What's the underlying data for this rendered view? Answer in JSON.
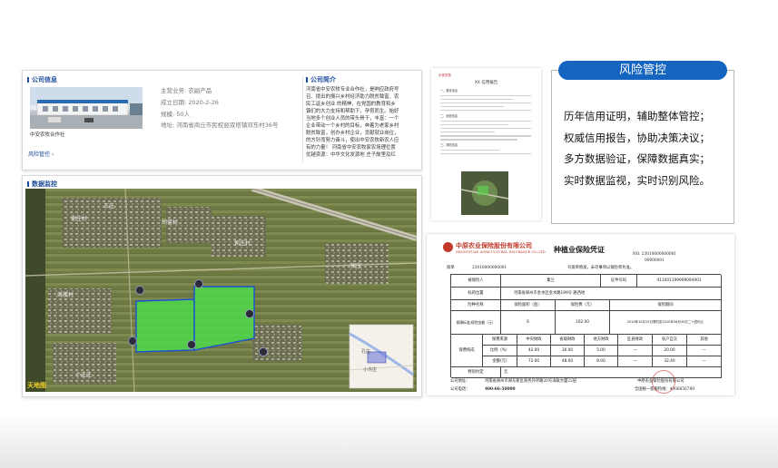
{
  "company_info": {
    "title": "公司信息",
    "name": "中安农牧合作社",
    "link": "风险管控 ›",
    "fields": [
      "主营业务: 农副产品",
      "成立日期: 2020-2-26",
      "规模: 50人",
      "地址: 河南省商丘市民权县双塔镇邓东村36号"
    ]
  },
  "company_intro": {
    "title": "公司简介",
    "lines": [
      "河南省中安农牧专业合作社，是响应政府号",
      "召、提出的振兴乡村经济助力脱贫致富、农",
      "民工返乡创业 的精神，在党国的教育和乡",
      "镇们的大力支持和帮助下，孕育而生。始好",
      "当地多个创业人员的带头骨干，丰富：一个",
      "企业带动一个乡村的目标，奔着为老家乡村",
      "脱贫致富，创办乡村企业，贡献就业岗位，",
      "的方针而努力奋斗，使出中安农牧新农人应",
      "有的力量！ 河南省中安农牧家农场理位置",
      "优越资源：中华文化发源地 庄子故里及红"
    ]
  },
  "monitor": {
    "title": "数据监控",
    "labels": [
      "王庄",
      "谢庄村",
      "郭庄村",
      "胡营村",
      "商楼村",
      "小庄庄",
      "双塔镇",
      "双塔乡",
      "孔庄",
      "侯庄",
      "双塔",
      "后营",
      "信阳",
      "小许庄"
    ],
    "watermark": "天地图"
  },
  "report": {
    "logo": "中安农牧",
    "title": "XX 信用报告",
    "fields": [
      "一、基本信息",
      "二、经营信息",
      "三、风险信息"
    ]
  },
  "risk": {
    "title": "风险管控",
    "lines": [
      "历年信用证明，辅助整体管控；",
      "权威信用报告，协助决策决议；",
      "多方数据验证，保障数据真实；",
      "实时数据监视，实时识别风险。"
    ]
  },
  "certificate": {
    "company_cn": "中原农业保险股份有限公司",
    "company_en": "ZHONGYUAN AGRICULTURAL INSURANCE CO.,LTD.",
    "title": "种植业保险凭证",
    "no_line": "NO. 23010000000001",
    "no_line2": "00000001",
    "policy_label": "保单",
    "policy_no": "23010000000001",
    "note": "号保单原发，未尽事项以保险单为准。",
    "insured_label": "被保险人",
    "insured_value": "集兰",
    "id_label": "证件号码",
    "id_value": "411001199909094901",
    "location_label": "标的位置",
    "location_value": "河南省郑州市金水区金水路199号 路西地",
    "h_name": "险种名称",
    "h_area": "保险面积（亩）",
    "h_premium": "保险费（元）",
    "h_period": "保险期间",
    "h_amount": "保障标准/保险金额（元）",
    "v_amount": "6",
    "v_premium": "102.00",
    "v_period": "2019年10月15日零时至2020年06月30日二十四时止",
    "row_label": "保费构成",
    "cols": [
      "保费来源",
      "中央财政",
      "省级财政",
      "地方财政",
      "区县财政",
      "农户自交",
      "其他"
    ],
    "ratio": [
      "比例（%）",
      "42.00",
      "30.00",
      "5.00",
      "—",
      "20.00",
      "—"
    ],
    "money": [
      "金额(元)",
      "72.00",
      "48.00",
      "8.00",
      "—",
      "32.40",
      "—"
    ],
    "special_label": "特别约定",
    "special_value": "无",
    "addr_label": "公司地址：",
    "addr_value": "河南省郑州市郑东新区商务外环路20号海联大厦22层",
    "phone_label": "公司电话：",
    "phone_value": "400-66-50000",
    "sign": "中原农业保险股份有限公司",
    "hotline": "全国统一客服热线：4006656789"
  }
}
